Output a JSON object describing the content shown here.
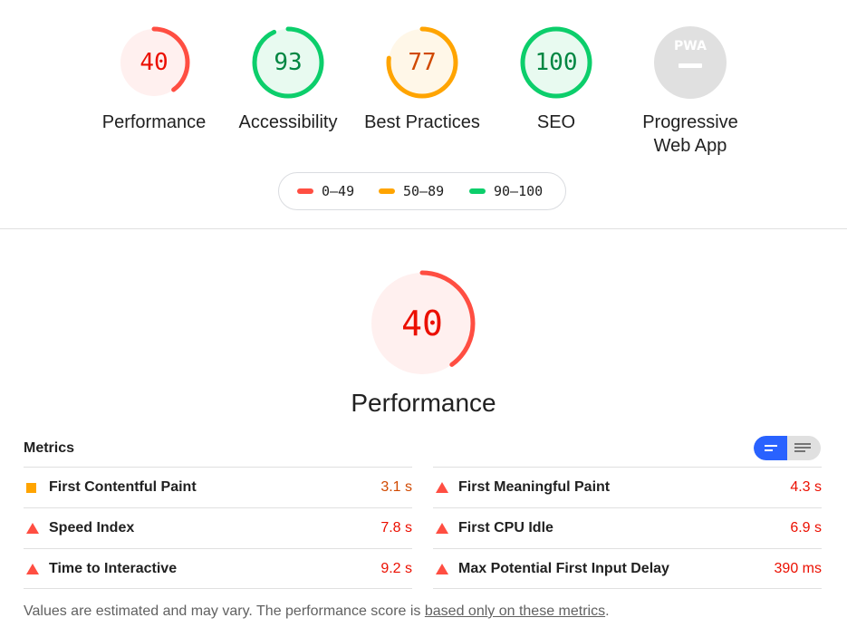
{
  "categories": [
    {
      "score": "40",
      "fraction": 0.4,
      "label": "Performance",
      "status": "fail"
    },
    {
      "score": "93",
      "fraction": 0.93,
      "label": "Accessibility",
      "status": "pass"
    },
    {
      "score": "77",
      "fraction": 0.77,
      "label": "Best Practices",
      "status": "average"
    },
    {
      "score": "100",
      "fraction": 1.0,
      "label": "SEO",
      "status": "pass"
    },
    {
      "score": "",
      "label_line1": "Progressive",
      "label_line2": "Web App",
      "badge": "PWA",
      "status": "na"
    }
  ],
  "legend": [
    {
      "range": "0–49",
      "color": "#ff4e42"
    },
    {
      "range": "50–89",
      "color": "#ffa400"
    },
    {
      "range": "90–100",
      "color": "#0cce6b"
    }
  ],
  "colors": {
    "fail": "#ff4e42",
    "fail_bg": "#fff0ef",
    "fail_text": "#eb0f00",
    "average": "#ffa400",
    "average_bg": "#fff7e8",
    "average_text": "#d04900",
    "pass": "#0cce6b",
    "pass_bg": "#e8faf0",
    "pass_text": "#018642",
    "na": "#e0e0e0",
    "toggle_active": "#2962ff"
  },
  "main": {
    "score": "40",
    "fraction": 0.4,
    "title": "Performance"
  },
  "metrics": {
    "title": "Metrics",
    "left": [
      {
        "name": "First Contentful Paint",
        "value": "3.1 s",
        "status": "average"
      },
      {
        "name": "Speed Index",
        "value": "7.8 s",
        "status": "fail"
      },
      {
        "name": "Time to Interactive",
        "value": "9.2 s",
        "status": "fail"
      }
    ],
    "right": [
      {
        "name": "First Meaningful Paint",
        "value": "4.3 s",
        "status": "fail"
      },
      {
        "name": "First CPU Idle",
        "value": "6.9 s",
        "status": "fail"
      },
      {
        "name": "Max Potential First Input Delay",
        "value": "390 ms",
        "status": "fail"
      }
    ]
  },
  "footnote": {
    "text": "Values are estimated and may vary. The performance score is ",
    "link": "based only on these metrics",
    "end": "."
  }
}
